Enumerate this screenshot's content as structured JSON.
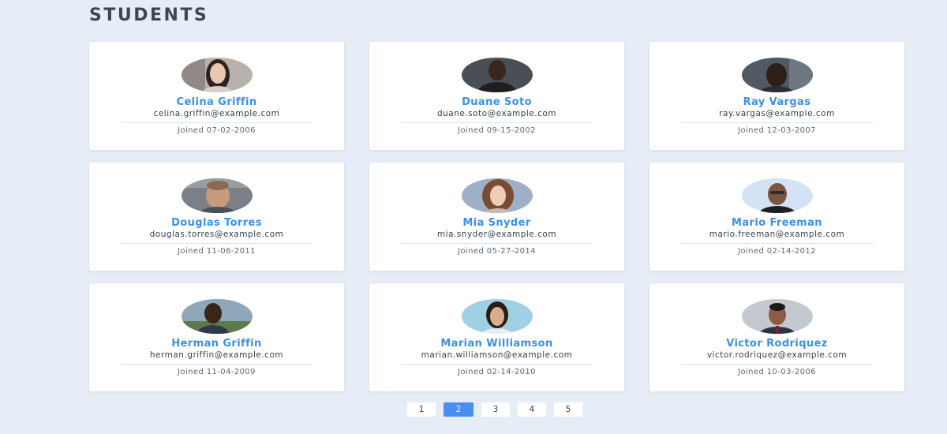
{
  "heading": "STUDENTS",
  "students": [
    {
      "name": "Celina Griffin",
      "email": "celina.griffin@example.com",
      "joined": "Joined 07-02-2006",
      "avatar": "female-portrait"
    },
    {
      "name": "Duane Soto",
      "email": "duane.soto@example.com",
      "joined": "Joined 09-15-2002",
      "avatar": "male-portrait"
    },
    {
      "name": "Ray Vargas",
      "email": "ray.vargas@example.com",
      "joined": "Joined 12-03-2007",
      "avatar": "male-portrait"
    },
    {
      "name": "Douglas Torres",
      "email": "douglas.torres@example.com",
      "joined": "Joined 11-06-2011",
      "avatar": "male-portrait"
    },
    {
      "name": "Mia Snyder",
      "email": "mia.snyder@example.com",
      "joined": "Joined 05-27-2014",
      "avatar": "female-portrait"
    },
    {
      "name": "Mario Freeman",
      "email": "mario.freeman@example.com",
      "joined": "Joined 02-14-2012",
      "avatar": "male-portrait"
    },
    {
      "name": "Herman Griffin",
      "email": "herman.griffin@example.com",
      "joined": "Joined 11-04-2009",
      "avatar": "male-portrait"
    },
    {
      "name": "Marian Williamson",
      "email": "marian.williamson@example.com",
      "joined": "Joined 02-14-2010",
      "avatar": "female-portrait"
    },
    {
      "name": "Victor Rodriquez",
      "email": "victor.rodriquez@example.com",
      "joined": "Joined 10-03-2006",
      "avatar": "male-portrait"
    }
  ],
  "pagination": {
    "pages": [
      "1",
      "2",
      "3",
      "4",
      "5"
    ],
    "current": "2"
  },
  "colors": {
    "background": "#e7edf7",
    "name_accent": "#3d8fe8",
    "active_page": "#4a8ef0",
    "heading": "#3b4656"
  }
}
